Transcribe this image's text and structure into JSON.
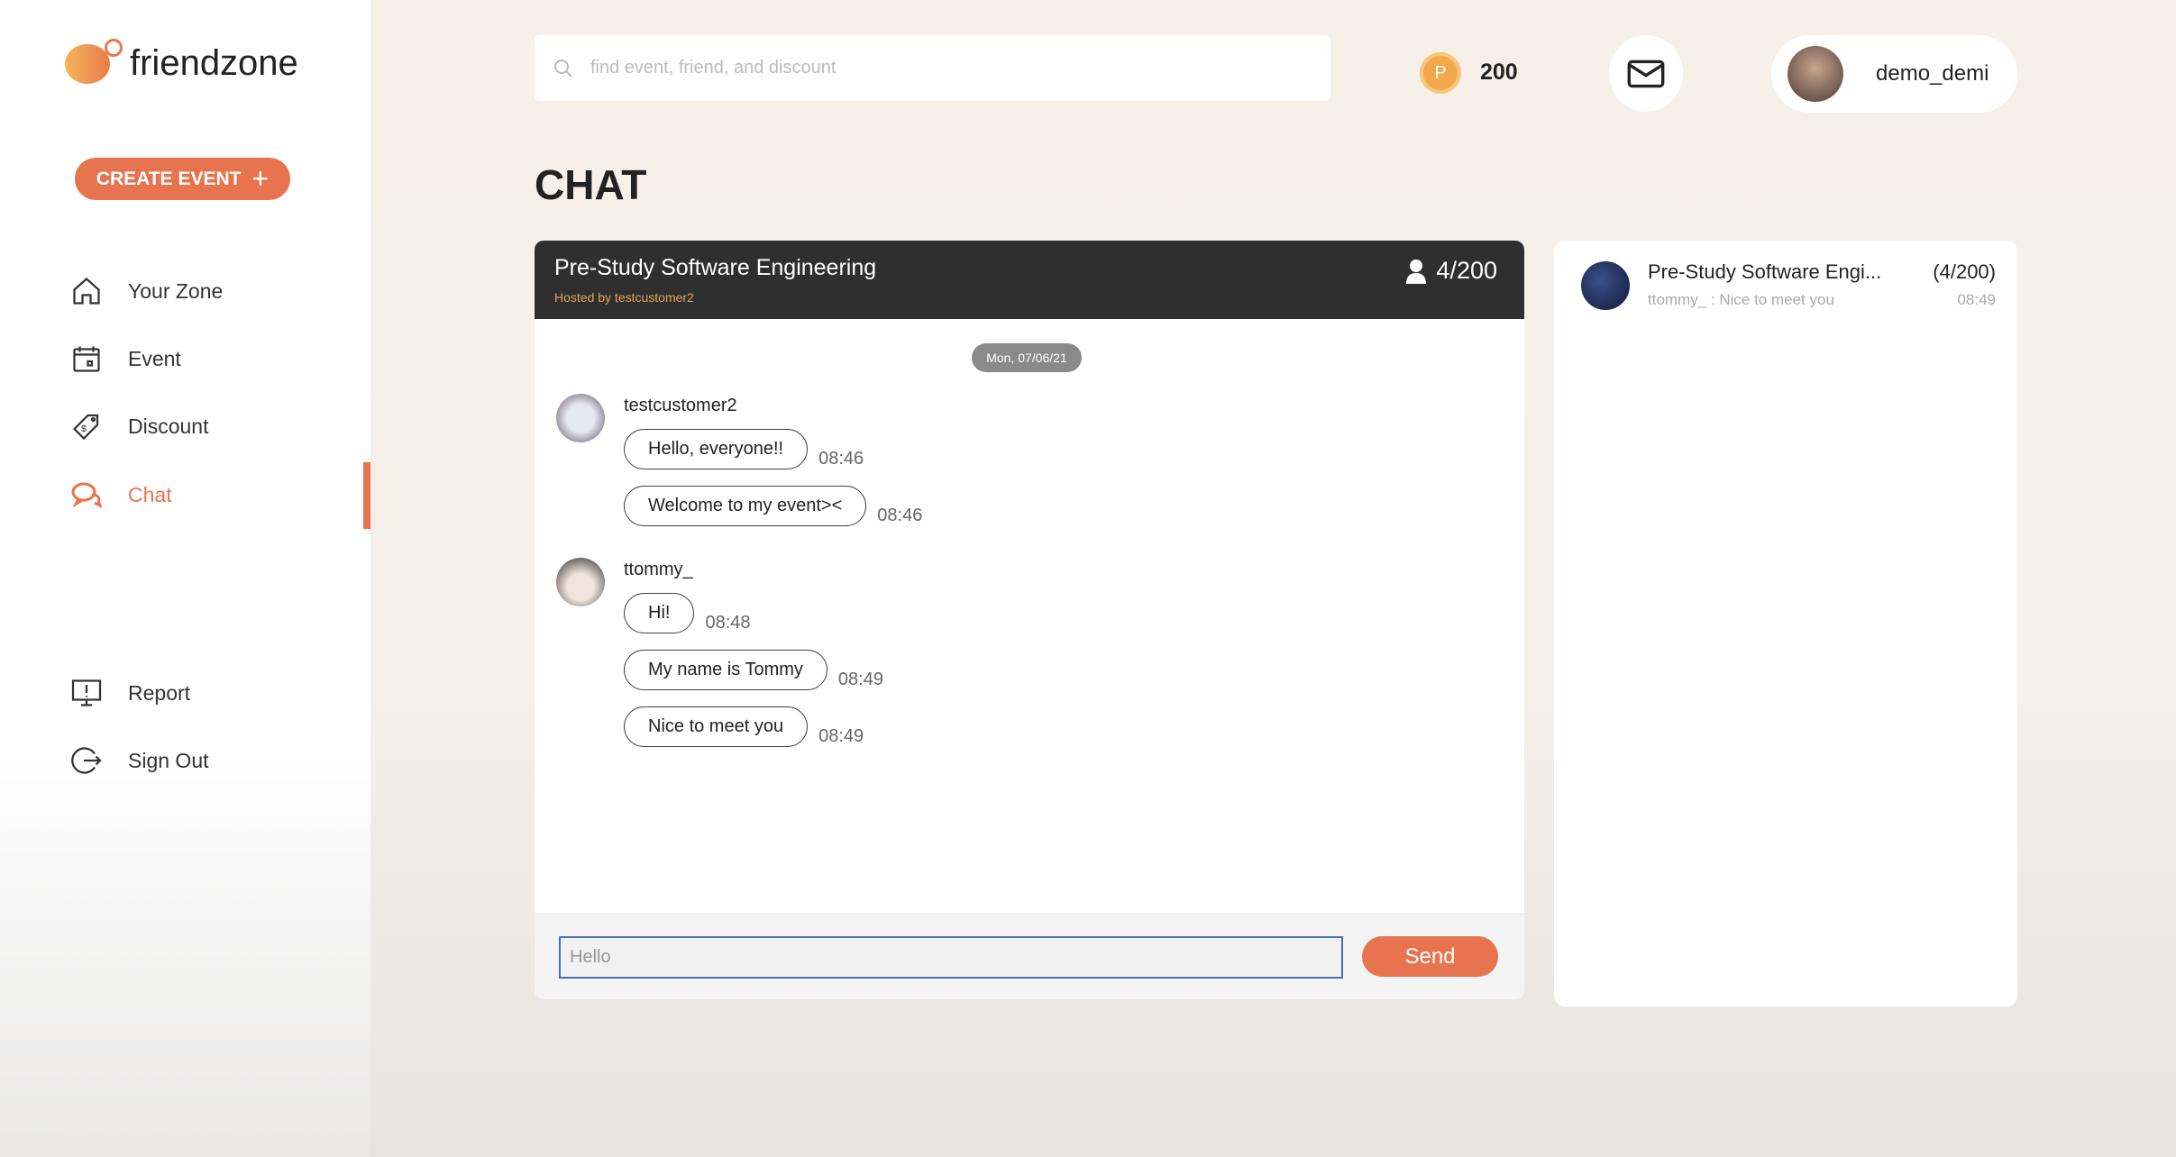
{
  "brand": {
    "name": "friendzone",
    "accent": "#e8744f"
  },
  "sidebar": {
    "create_event": "CREATE EVENT",
    "create_icon": "+",
    "items": [
      {
        "label": "Your Zone",
        "icon": "home-icon"
      },
      {
        "label": "Event",
        "icon": "calendar-icon"
      },
      {
        "label": "Discount",
        "icon": "tag-icon"
      },
      {
        "label": "Chat",
        "icon": "chat-icon",
        "active": true
      },
      {
        "label": "Report",
        "icon": "monitor-icon"
      },
      {
        "label": "Sign Out",
        "icon": "sign-out-icon"
      }
    ]
  },
  "header": {
    "search_placeholder": "find event, friend, and discount",
    "coin_symbol": "P",
    "points": "200",
    "username": "demo_demi"
  },
  "page_title": "CHAT",
  "chat": {
    "title": "Pre-Study Software Engineering",
    "host": "Hosted by testcustomer2",
    "members": "4/200",
    "date": "Mon, 07/06/21",
    "groups": [
      {
        "user": "testcustomer2",
        "messages": [
          {
            "text": "Hello, everyone!!",
            "time": "08:46"
          },
          {
            "text": "Welcome to my event><",
            "time": "08:46"
          }
        ]
      },
      {
        "user": "ttommy_",
        "messages": [
          {
            "text": "Hi!",
            "time": "08:48"
          },
          {
            "text": "My name is Tommy",
            "time": "08:49"
          },
          {
            "text": "Nice to meet you",
            "time": "08:49"
          }
        ]
      }
    ],
    "input_value": "Hello",
    "send_label": "Send"
  },
  "rooms": [
    {
      "name": "Pre-Study Software Engi...",
      "count": "(4/200)",
      "last": "ttommy_ : Nice to meet you",
      "time": "08:49"
    }
  ]
}
